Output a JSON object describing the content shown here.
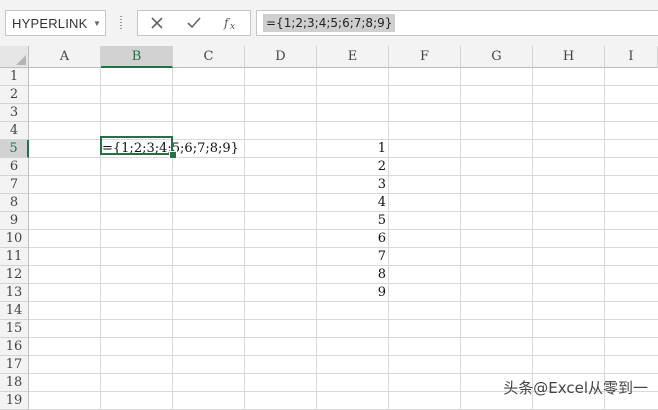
{
  "formula_bar": {
    "name_box": "HYPERLINK",
    "formula": "={1;2;3;4;5;6;7;8;9}",
    "icons": [
      "cancel-icon",
      "confirm-icon",
      "insert-function-icon"
    ]
  },
  "sheet": {
    "columns": [
      "A",
      "B",
      "C",
      "D",
      "E",
      "F",
      "G",
      "H",
      "I"
    ],
    "rows": [
      "1",
      "2",
      "3",
      "4",
      "5",
      "6",
      "7",
      "8",
      "9",
      "10",
      "11",
      "12",
      "13",
      "14",
      "15",
      "16",
      "17",
      "18",
      "19"
    ],
    "selected_column": "B",
    "selected_row": "5",
    "active_cell_content": "={1;2;3;4;5;6;7;8;9}",
    "column_e_values": [
      "1",
      "2",
      "3",
      "4",
      "5",
      "6",
      "7",
      "8",
      "9"
    ]
  },
  "colors": {
    "accent": "#217346",
    "grid": "#d9d9d9",
    "header_bg": "#f3f3f3"
  },
  "watermark": "头条@Excel从零到一"
}
